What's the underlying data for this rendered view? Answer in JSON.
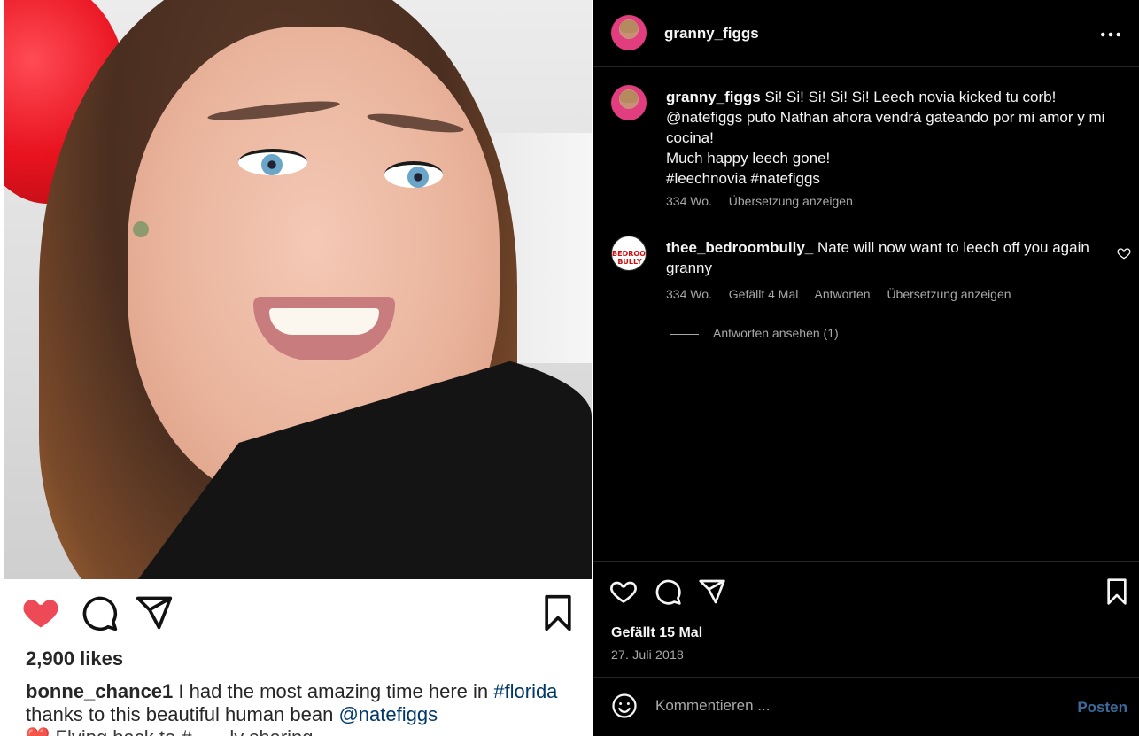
{
  "post": {
    "author": "granny_figgs",
    "more_icon": "more-options-icon",
    "caption_comment": {
      "username": "granny_figgs",
      "text": " Si! Si! Si! Si! Si! Leech novia kicked tu corb!\n@natefiggs puto Nathan ahora vendrá gateando por mi amor y mi cocina!\nMuch happy leech gone!\n#leechnovia #natefiggs",
      "time": "334 Wo.",
      "translate": "Übersetzung anzeigen"
    },
    "comments": [
      {
        "username": "thee_bedroombully_",
        "avatar_text_1": "BEDROOM",
        "avatar_text_2": "BULLY",
        "text": " Nate will now want to leech off you again granny",
        "time": "334 Wo.",
        "likes": "Gefällt 4 Mal",
        "reply": "Antworten",
        "translate": "Übersetzung anzeigen",
        "view_replies": "Antworten ansehen (1)"
      }
    ],
    "likes": "Gefällt 15 Mal",
    "date": "27. Juli 2018",
    "comment_placeholder": "Kommentieren ...",
    "post_button": "Posten"
  },
  "embedded_image": {
    "likes": "2,900 likes",
    "username": "bonne_chance1",
    "caption_a": " I had the most amazing time here in",
    "tag": "#florida",
    "caption_b": " thanks to this beautiful human bean ",
    "mention": "@natefiggs",
    "cut_line": "❤️ Flying back to #...     ...ly sharing"
  },
  "colors": {
    "background": "#000000",
    "text": "#f5f5f5",
    "secondary": "#a8a8a8",
    "like_red": "#ed4956",
    "post_blue": "#3c6a9c"
  }
}
